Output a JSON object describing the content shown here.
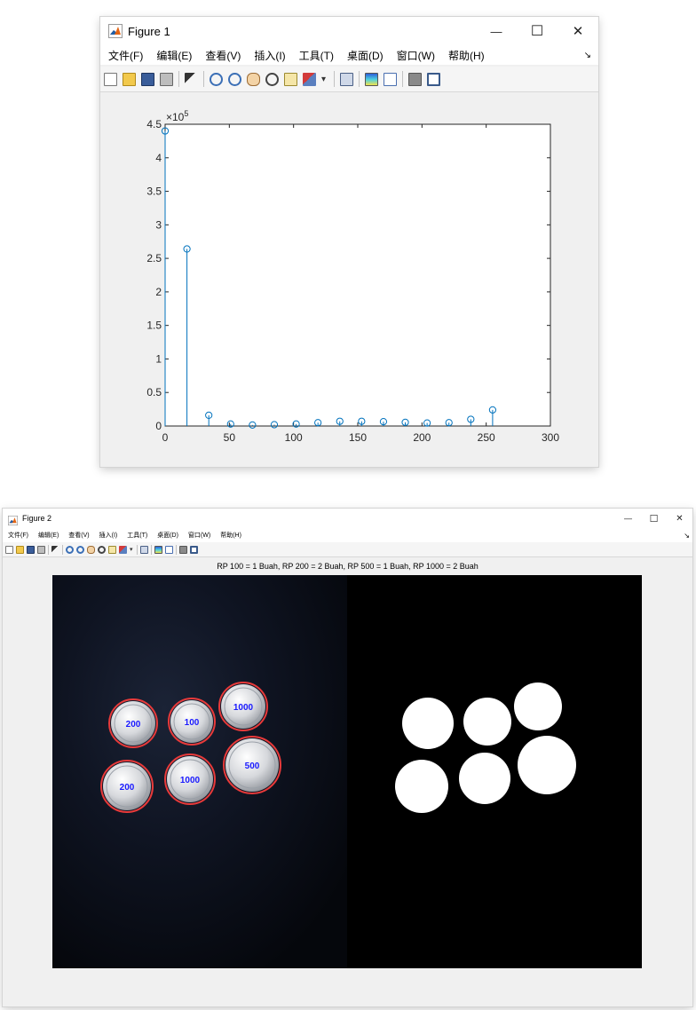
{
  "figure1": {
    "title": "Figure 1",
    "window_buttons": {
      "minimize": "—",
      "maximize": "☐",
      "close": "✕"
    },
    "menu": [
      "文件(F)",
      "编辑(E)",
      "查看(V)",
      "插入(I)",
      "工具(T)",
      "桌面(D)",
      "窗口(W)",
      "帮助(H)"
    ],
    "menu_overflow": "↘",
    "toolbar_icons": [
      "new-figure-icon",
      "open-file-icon",
      "save-icon",
      "print-icon",
      "select-arrow-icon",
      "zoom-in-icon",
      "zoom-out-icon",
      "pan-hand-icon",
      "rotate-3d-icon",
      "data-cursor-icon",
      "brush-icon",
      "dropdown-arrow-icon",
      "link-plot-icon",
      "colorbar-icon",
      "legend-icon",
      "hide-plot-tools-icon",
      "show-plot-tools-icon"
    ],
    "axes": {
      "exponent": "×10",
      "exponent_power": "5"
    },
    "chart_data": {
      "type": "stem",
      "x": [
        0,
        17,
        34,
        51,
        68,
        85,
        102,
        119,
        136,
        153,
        170,
        187,
        204,
        221,
        238,
        255
      ],
      "y": [
        440000,
        264000,
        16000,
        3000,
        1500,
        2000,
        3000,
        5000,
        7000,
        7000,
        6500,
        5500,
        4500,
        5000,
        10000,
        24000
      ],
      "xlim": [
        0,
        300
      ],
      "ylim": [
        0,
        450000
      ],
      "xticks": [
        0,
        50,
        100,
        150,
        200,
        250,
        300
      ],
      "xtick_labels": [
        "0",
        "50",
        "100",
        "150",
        "200",
        "250",
        "300"
      ],
      "yticks": [
        0,
        50000,
        100000,
        150000,
        200000,
        250000,
        300000,
        350000,
        400000,
        450000
      ],
      "ytick_labels": [
        "0",
        "0.5",
        "1",
        "1.5",
        "2",
        "2.5",
        "3",
        "3.5",
        "4",
        "4.5"
      ],
      "marker": "circle",
      "color": "#0072bd",
      "grid": false
    }
  },
  "figure2": {
    "title": "Figure 2",
    "window_buttons": {
      "minimize": "—",
      "maximize": "☐",
      "close": "✕"
    },
    "menu": [
      "文件(F)",
      "编辑(E)",
      "查看(V)",
      "插入(I)",
      "工具(T)",
      "桌面(D)",
      "窗口(W)",
      "帮助(H)"
    ],
    "menu_overflow": "↘",
    "toolbar_icons": [
      "new-figure-icon",
      "open-file-icon",
      "save-icon",
      "print-icon",
      "select-arrow-icon",
      "zoom-in-icon",
      "zoom-out-icon",
      "pan-hand-icon",
      "rotate-3d-icon",
      "data-cursor-icon",
      "brush-icon",
      "dropdown-arrow-icon",
      "link-plot-icon",
      "colorbar-icon",
      "legend-icon",
      "hide-plot-tools-icon",
      "show-plot-tools-icon"
    ],
    "image_title": "RP 100 = 1 Buah, RP 200 = 2 Buah, RP 500 = 1 Buah, RP 1000 = 2 Buah",
    "coins": [
      {
        "label": "200"
      },
      {
        "label": "100"
      },
      {
        "label": "1000"
      },
      {
        "label": "200"
      },
      {
        "label": "1000"
      },
      {
        "label": "500"
      }
    ],
    "colors": {
      "circle": "#e83a3a",
      "label": "#1a1aff",
      "mask": "#ffffff",
      "background": "#000000"
    }
  }
}
